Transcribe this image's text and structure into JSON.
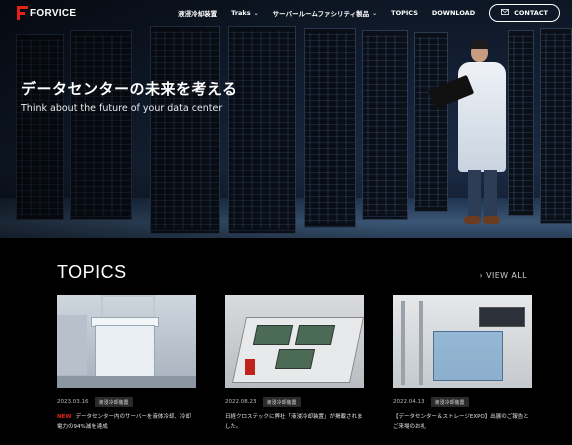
{
  "nav": {
    "logo_text": "FORVICE",
    "links": [
      {
        "label": "液浸冷却装置",
        "has_dropdown": false
      },
      {
        "label": "Traks",
        "has_dropdown": true
      },
      {
        "label": "サーバールームファシリティ製品",
        "has_dropdown": true
      },
      {
        "label": "TOPICS",
        "has_dropdown": false
      },
      {
        "label": "DOWNLOAD",
        "has_dropdown": false
      }
    ],
    "contact_label": "CONTACT",
    "contact_icon": "mail-icon"
  },
  "hero": {
    "title": "データセンターの未来を考える",
    "subtitle": "Think about the future of your data center"
  },
  "topics": {
    "heading": "TOPICS",
    "view_all": "› VIEW ALL",
    "items": [
      {
        "date": "2023.03.16",
        "tag": "液浸冷却装置",
        "is_new": true,
        "new_label": "NEW",
        "text": "データセンター内のサーバーを液体冷却、冷却電力の94%減を達成"
      },
      {
        "date": "2022.08.23",
        "tag": "液浸冷却装置",
        "is_new": false,
        "new_label": "",
        "text": "日経クロステックに弊社「液浸冷却装置」が掲載されました。"
      },
      {
        "date": "2022.04.13",
        "tag": "液浸冷却装置",
        "is_new": false,
        "new_label": "",
        "text": "【データセンター＆ストレージEXPO】出展のご報告とご来場のお礼"
      }
    ]
  },
  "colors": {
    "brand_red": "#e2231a",
    "background": "#000000"
  }
}
